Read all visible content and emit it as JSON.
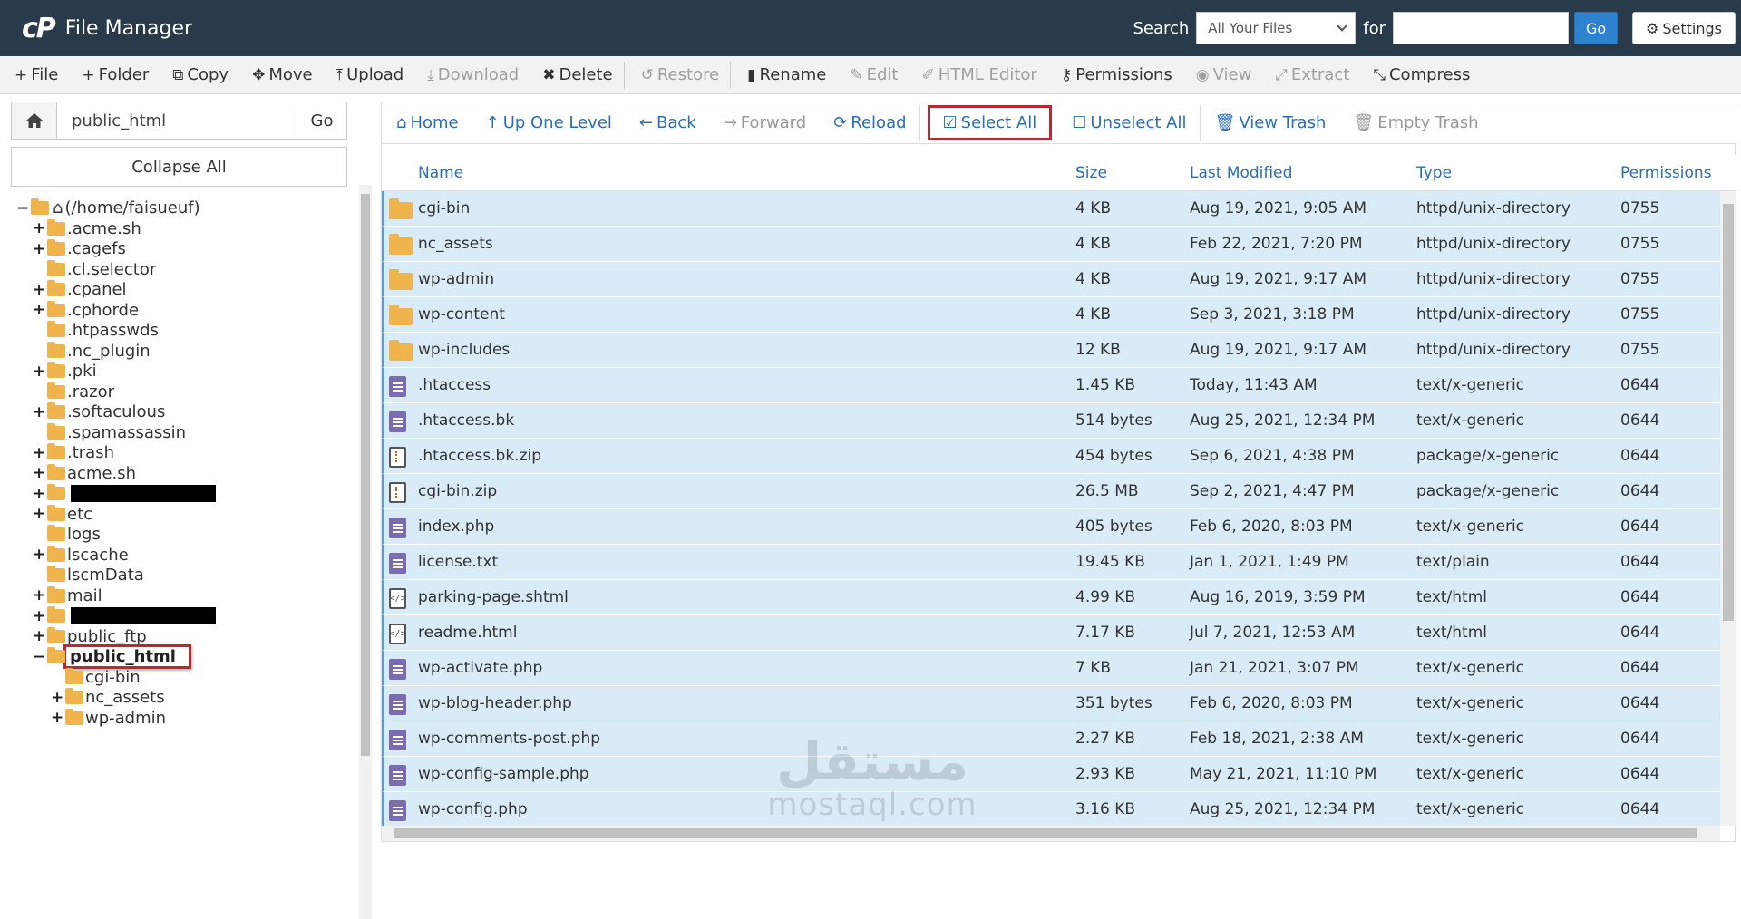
{
  "header": {
    "logo_mark": "cP",
    "title": "File Manager",
    "search_label": "Search",
    "search_scope": "All Your Files",
    "for_label": "for",
    "search_value": "",
    "go_label": "Go",
    "settings_label": "Settings"
  },
  "toolbar": {
    "items": [
      {
        "label": "File",
        "icon": "plus-icon",
        "icon_glyph": "+",
        "enabled": true
      },
      {
        "label": "Folder",
        "icon": "plus-icon",
        "icon_glyph": "+",
        "enabled": true
      },
      {
        "label": "Copy",
        "icon": "copy-icon",
        "icon_glyph": "⧉",
        "enabled": true
      },
      {
        "label": "Move",
        "icon": "move-icon",
        "icon_glyph": "✥",
        "enabled": true
      },
      {
        "label": "Upload",
        "icon": "upload-icon",
        "icon_glyph": "⤒",
        "enabled": true
      },
      {
        "label": "Download",
        "icon": "download-icon",
        "icon_glyph": "⤓",
        "enabled": false
      },
      {
        "label": "Delete",
        "icon": "close-icon",
        "icon_glyph": "✖",
        "enabled": true
      },
      {
        "label": "Restore",
        "icon": "restore-icon",
        "icon_glyph": "↺",
        "enabled": false
      },
      {
        "label": "Rename",
        "icon": "file-icon",
        "icon_glyph": "▮",
        "enabled": true
      },
      {
        "label": "Edit",
        "icon": "pencil-icon",
        "icon_glyph": "✎",
        "enabled": false
      },
      {
        "label": "HTML Editor",
        "icon": "html-editor-icon",
        "icon_glyph": "✐",
        "enabled": false
      },
      {
        "label": "Permissions",
        "icon": "key-icon",
        "icon_glyph": "⚷",
        "enabled": true
      },
      {
        "label": "View",
        "icon": "eye-icon",
        "icon_glyph": "◉",
        "enabled": false
      },
      {
        "label": "Extract",
        "icon": "expand-icon",
        "icon_glyph": "⤢",
        "enabled": false
      },
      {
        "label": "Compress",
        "icon": "compress-icon",
        "icon_glyph": "⤡",
        "enabled": true
      }
    ]
  },
  "sidebar": {
    "path_value": "public_html",
    "go_label": "Go",
    "collapse_label": "Collapse All",
    "tree": [
      {
        "label": "(/home/faisueuf)",
        "toggle": "−",
        "indent": 0,
        "kind": "root"
      },
      {
        "label": ".acme.sh",
        "toggle": "+",
        "indent": 1
      },
      {
        "label": ".cagefs",
        "toggle": "+",
        "indent": 1
      },
      {
        "label": ".cl.selector",
        "toggle": "",
        "indent": 1
      },
      {
        "label": ".cpanel",
        "toggle": "+",
        "indent": 1
      },
      {
        "label": ".cphorde",
        "toggle": "+",
        "indent": 1
      },
      {
        "label": ".htpasswds",
        "toggle": "",
        "indent": 1
      },
      {
        "label": ".nc_plugin",
        "toggle": "",
        "indent": 1
      },
      {
        "label": ".pki",
        "toggle": "+",
        "indent": 1
      },
      {
        "label": ".razor",
        "toggle": "",
        "indent": 1
      },
      {
        "label": ".softaculous",
        "toggle": "+",
        "indent": 1
      },
      {
        "label": ".spamassassin",
        "toggle": "",
        "indent": 1
      },
      {
        "label": ".trash",
        "toggle": "+",
        "indent": 1
      },
      {
        "label": "acme.sh",
        "toggle": "+",
        "indent": 1
      },
      {
        "label": "",
        "toggle": "+",
        "indent": 1,
        "kind": "redacted"
      },
      {
        "label": "etc",
        "toggle": "+",
        "indent": 1
      },
      {
        "label": "logs",
        "toggle": "",
        "indent": 1
      },
      {
        "label": "lscache",
        "toggle": "+",
        "indent": 1
      },
      {
        "label": "lscmData",
        "toggle": "",
        "indent": 1
      },
      {
        "label": "mail",
        "toggle": "+",
        "indent": 1
      },
      {
        "label": "",
        "toggle": "+",
        "indent": 1,
        "kind": "redacted"
      },
      {
        "label": "public_ftp",
        "toggle": "+",
        "indent": 1
      },
      {
        "label": "public_html",
        "toggle": "−",
        "indent": 1,
        "kind": "selected"
      },
      {
        "label": "cgi-bin",
        "toggle": "",
        "indent": 2
      },
      {
        "label": "nc_assets",
        "toggle": "+",
        "indent": 2
      },
      {
        "label": "wp-admin",
        "toggle": "+",
        "indent": 2
      }
    ]
  },
  "nav": {
    "items": [
      {
        "label": "Home",
        "icon": "home-icon",
        "icon_glyph": "⌂",
        "enabled": true
      },
      {
        "label": "Up One Level",
        "icon": "arrow-up-icon",
        "icon_glyph": "↑",
        "enabled": true
      },
      {
        "label": "Back",
        "icon": "arrow-left-icon",
        "icon_glyph": "←",
        "enabled": true
      },
      {
        "label": "Forward",
        "icon": "arrow-right-icon",
        "icon_glyph": "→",
        "enabled": false
      },
      {
        "label": "Reload",
        "icon": "reload-icon",
        "icon_glyph": "⟳",
        "enabled": true
      },
      {
        "label": "Select All",
        "icon": "checkbox-checked-icon",
        "icon_glyph": "☑",
        "enabled": true,
        "highlight": true
      },
      {
        "label": "Unselect All",
        "icon": "checkbox-empty-icon",
        "icon_glyph": "☐",
        "enabled": true
      },
      {
        "label": "View Trash",
        "icon": "trash-icon",
        "icon_glyph": "🗑",
        "enabled": true
      },
      {
        "label": "Empty Trash",
        "icon": "trash-icon",
        "icon_glyph": "🗑",
        "enabled": false
      }
    ]
  },
  "table": {
    "columns": [
      "Name",
      "Size",
      "Last Modified",
      "Type",
      "Permissions"
    ],
    "rows": [
      {
        "icon": "folder-icon",
        "name": "cgi-bin",
        "size": "4 KB",
        "modified": "Aug 19, 2021, 9:05 AM",
        "type": "httpd/unix-directory",
        "perms": "0755"
      },
      {
        "icon": "folder-icon",
        "name": "nc_assets",
        "size": "4 KB",
        "modified": "Feb 22, 2021, 7:20 PM",
        "type": "httpd/unix-directory",
        "perms": "0755"
      },
      {
        "icon": "folder-icon",
        "name": "wp-admin",
        "size": "4 KB",
        "modified": "Aug 19, 2021, 9:17 AM",
        "type": "httpd/unix-directory",
        "perms": "0755"
      },
      {
        "icon": "folder-icon",
        "name": "wp-content",
        "size": "4 KB",
        "modified": "Sep 3, 2021, 3:18 PM",
        "type": "httpd/unix-directory",
        "perms": "0755"
      },
      {
        "icon": "folder-icon",
        "name": "wp-includes",
        "size": "12 KB",
        "modified": "Aug 19, 2021, 9:17 AM",
        "type": "httpd/unix-directory",
        "perms": "0755"
      },
      {
        "icon": "text-file-icon",
        "name": ".htaccess",
        "size": "1.45 KB",
        "modified": "Today, 11:43 AM",
        "type": "text/x-generic",
        "perms": "0644"
      },
      {
        "icon": "text-file-icon",
        "name": ".htaccess.bk",
        "size": "514 bytes",
        "modified": "Aug 25, 2021, 12:34 PM",
        "type": "text/x-generic",
        "perms": "0644"
      },
      {
        "icon": "zip-file-icon",
        "name": ".htaccess.bk.zip",
        "size": "454 bytes",
        "modified": "Sep 6, 2021, 4:38 PM",
        "type": "package/x-generic",
        "perms": "0644"
      },
      {
        "icon": "zip-file-icon",
        "name": "cgi-bin.zip",
        "size": "26.5 MB",
        "modified": "Sep 2, 2021, 4:47 PM",
        "type": "package/x-generic",
        "perms": "0644"
      },
      {
        "icon": "text-file-icon",
        "name": "index.php",
        "size": "405 bytes",
        "modified": "Feb 6, 2020, 8:03 PM",
        "type": "text/x-generic",
        "perms": "0644"
      },
      {
        "icon": "text-file-icon",
        "name": "license.txt",
        "size": "19.45 KB",
        "modified": "Jan 1, 2021, 1:49 PM",
        "type": "text/plain",
        "perms": "0644"
      },
      {
        "icon": "html-file-icon",
        "name": "parking-page.shtml",
        "size": "4.99 KB",
        "modified": "Aug 16, 2019, 3:59 PM",
        "type": "text/html",
        "perms": "0644"
      },
      {
        "icon": "html-file-icon",
        "name": "readme.html",
        "size": "7.17 KB",
        "modified": "Jul 7, 2021, 12:53 AM",
        "type": "text/html",
        "perms": "0644"
      },
      {
        "icon": "text-file-icon",
        "name": "wp-activate.php",
        "size": "7 KB",
        "modified": "Jan 21, 2021, 3:07 PM",
        "type": "text/x-generic",
        "perms": "0644"
      },
      {
        "icon": "text-file-icon",
        "name": "wp-blog-header.php",
        "size": "351 bytes",
        "modified": "Feb 6, 2020, 8:03 PM",
        "type": "text/x-generic",
        "perms": "0644"
      },
      {
        "icon": "text-file-icon",
        "name": "wp-comments-post.php",
        "size": "2.27 KB",
        "modified": "Feb 18, 2021, 2:38 AM",
        "type": "text/x-generic",
        "perms": "0644"
      },
      {
        "icon": "text-file-icon",
        "name": "wp-config-sample.php",
        "size": "2.93 KB",
        "modified": "May 21, 2021, 11:10 PM",
        "type": "text/x-generic",
        "perms": "0644"
      },
      {
        "icon": "text-file-icon",
        "name": "wp-config.php",
        "size": "3.16 KB",
        "modified": "Aug 25, 2021, 12:34 PM",
        "type": "text/x-generic",
        "perms": "0644"
      }
    ]
  },
  "watermark": {
    "arabic": "مستقل",
    "latin": "mostaql.com"
  },
  "colors": {
    "header_bg": "#293a4a",
    "accent": "#2e83d0",
    "link": "#2a6fb5",
    "selected_row": "#d9ebf7",
    "highlight_border": "#c0272d",
    "folder": "#f0b44c",
    "text_file": "#7b6bb0"
  }
}
